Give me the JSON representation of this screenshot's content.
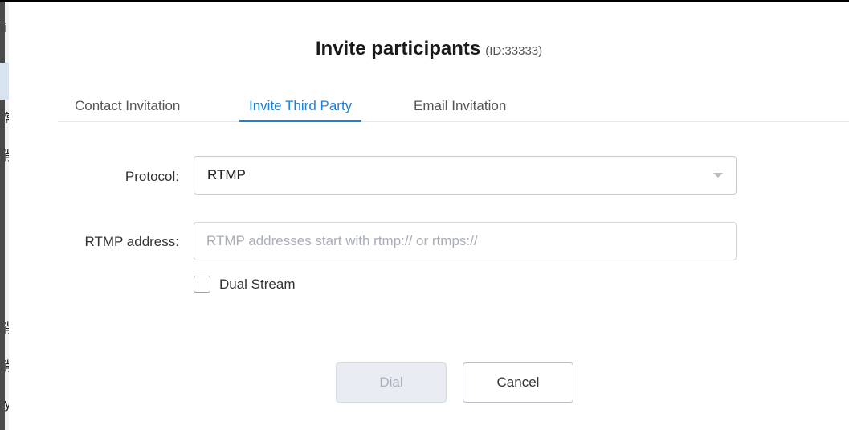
{
  "background_window": {
    "glyphs": [
      "i",
      "常",
      "削",
      "削",
      "削",
      "y"
    ]
  },
  "dialog": {
    "title": "Invite participants",
    "meeting_id": "(ID:33333)",
    "tabs": [
      {
        "label": "Contact Invitation",
        "active": false
      },
      {
        "label": "Invite Third Party",
        "active": true
      },
      {
        "label": "Email Invitation",
        "active": false
      }
    ],
    "form": {
      "protocol_label": "Protocol:",
      "protocol_value": "RTMP",
      "address_label": "RTMP address:",
      "address_value": "",
      "address_placeholder": "RTMP addresses start with rtmp:// or rtmps://",
      "dual_stream_label": "Dual Stream",
      "dual_stream_checked": false
    },
    "buttons": {
      "dial_label": "Dial",
      "dial_enabled": false,
      "cancel_label": "Cancel"
    }
  },
  "colors": {
    "accent": "#1e7fd6",
    "disabled_button_bg": "#e9edf3",
    "border": "#c8ccd2"
  },
  "icons": {
    "dropdown": "caret-down-icon",
    "checkbox": "checkbox-unchecked-icon"
  }
}
